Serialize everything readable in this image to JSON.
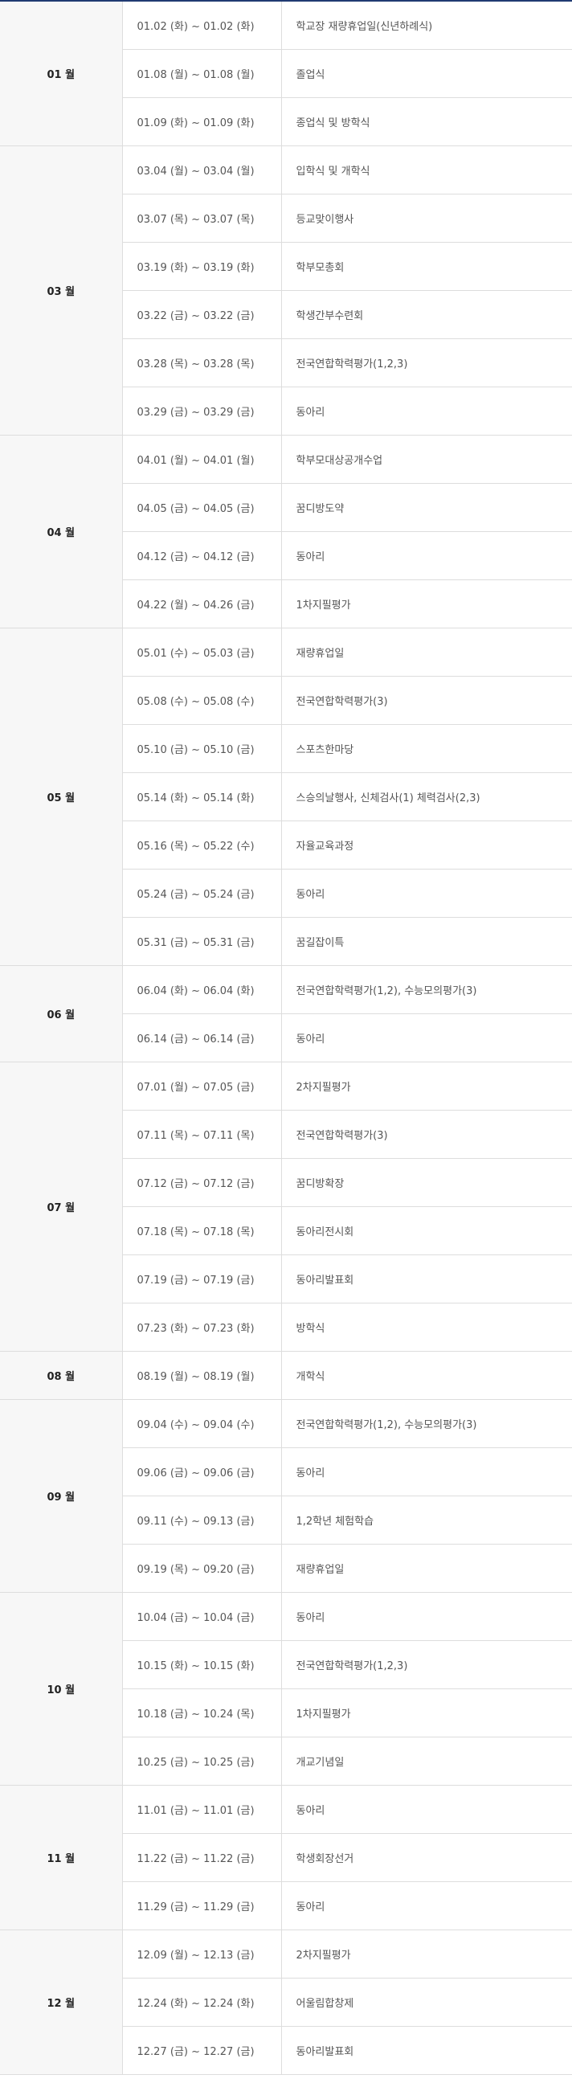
{
  "months": [
    {
      "label": "01 월",
      "rows": [
        {
          "date": "01.02 (화) ~ 01.02 (화)",
          "event": "학교장 재량휴업일(신년하례식)"
        },
        {
          "date": "01.08 (월) ~ 01.08 (월)",
          "event": "졸업식"
        },
        {
          "date": "01.09 (화) ~ 01.09 (화)",
          "event": "종업식 및 방학식"
        }
      ]
    },
    {
      "label": "03 월",
      "rows": [
        {
          "date": "03.04 (월) ~ 03.04 (월)",
          "event": "입학식 및 개학식"
        },
        {
          "date": "03.07 (목) ~ 03.07 (목)",
          "event": "등교맞이행사"
        },
        {
          "date": "03.19 (화) ~ 03.19 (화)",
          "event": "학부모총회"
        },
        {
          "date": "03.22 (금) ~ 03.22 (금)",
          "event": "학생간부수련회"
        },
        {
          "date": "03.28 (목) ~ 03.28 (목)",
          "event": "전국연합학력평가(1,2,3)"
        },
        {
          "date": "03.29 (금) ~ 03.29 (금)",
          "event": "동아리"
        }
      ]
    },
    {
      "label": "04 월",
      "rows": [
        {
          "date": "04.01 (월) ~ 04.01 (월)",
          "event": "학부모대상공개수업"
        },
        {
          "date": "04.05 (금) ~ 04.05 (금)",
          "event": "꿈디방도약"
        },
        {
          "date": "04.12 (금) ~ 04.12 (금)",
          "event": "동아리"
        },
        {
          "date": "04.22 (월) ~ 04.26 (금)",
          "event": "1차지필평가"
        }
      ]
    },
    {
      "label": "05 월",
      "rows": [
        {
          "date": "05.01 (수) ~ 05.03 (금)",
          "event": "재량휴업일"
        },
        {
          "date": "05.08 (수) ~ 05.08 (수)",
          "event": "전국연합학력평가(3)"
        },
        {
          "date": "05.10 (금) ~ 05.10 (금)",
          "event": "스포츠한마당"
        },
        {
          "date": "05.14 (화) ~ 05.14 (화)",
          "event": "스승의날행사, 신체검사(1) 체력검사(2,3)"
        },
        {
          "date": "05.16 (목) ~ 05.22 (수)",
          "event": "자율교육과정"
        },
        {
          "date": "05.24 (금) ~ 05.24 (금)",
          "event": "동아리"
        },
        {
          "date": "05.31 (금) ~ 05.31 (금)",
          "event": "꿈길잡이특"
        }
      ]
    },
    {
      "label": "06 월",
      "rows": [
        {
          "date": "06.04 (화) ~ 06.04 (화)",
          "event": "전국연합학력평가(1,2), 수능모의평가(3)"
        },
        {
          "date": "06.14 (금) ~ 06.14 (금)",
          "event": "동아리"
        }
      ]
    },
    {
      "label": "07 월",
      "rows": [
        {
          "date": "07.01 (월) ~ 07.05 (금)",
          "event": "2차지필평가"
        },
        {
          "date": "07.11 (목) ~ 07.11 (목)",
          "event": "전국연합학력평가(3)"
        },
        {
          "date": "07.12 (금) ~ 07.12 (금)",
          "event": "꿈디방확장"
        },
        {
          "date": "07.18 (목) ~ 07.18 (목)",
          "event": "동아리전시회"
        },
        {
          "date": "07.19 (금) ~ 07.19 (금)",
          "event": "동아리발표회"
        },
        {
          "date": "07.23 (화) ~ 07.23 (화)",
          "event": "방학식"
        }
      ]
    },
    {
      "label": "08 월",
      "rows": [
        {
          "date": "08.19 (월) ~ 08.19 (월)",
          "event": "개학식"
        }
      ]
    },
    {
      "label": "09 월",
      "rows": [
        {
          "date": "09.04 (수) ~ 09.04 (수)",
          "event": "전국연합학력평가(1,2), 수능모의평가(3)"
        },
        {
          "date": "09.06 (금) ~ 09.06 (금)",
          "event": "동아리"
        },
        {
          "date": "09.11 (수) ~ 09.13 (금)",
          "event": "1,2학년 체험학습"
        },
        {
          "date": "09.19 (목) ~ 09.20 (금)",
          "event": "재량휴업일"
        }
      ]
    },
    {
      "label": "10 월",
      "rows": [
        {
          "date": "10.04 (금) ~ 10.04 (금)",
          "event": "동아리"
        },
        {
          "date": "10.15 (화) ~ 10.15 (화)",
          "event": "전국연합학력평가(1,2,3)"
        },
        {
          "date": "10.18 (금) ~ 10.24 (목)",
          "event": "1차지필평가"
        },
        {
          "date": "10.25 (금) ~ 10.25 (금)",
          "event": "개교기념일"
        }
      ]
    },
    {
      "label": "11 월",
      "rows": [
        {
          "date": "11.01 (금) ~ 11.01 (금)",
          "event": "동아리"
        },
        {
          "date": "11.22 (금) ~ 11.22 (금)",
          "event": "학생회장선거"
        },
        {
          "date": "11.29 (금) ~ 11.29 (금)",
          "event": "동아리"
        }
      ]
    },
    {
      "label": "12 월",
      "rows": [
        {
          "date": "12.09 (월) ~ 12.13 (금)",
          "event": "2차지필평가"
        },
        {
          "date": "12.24 (화) ~ 12.24 (화)",
          "event": "어울림합창제"
        },
        {
          "date": "12.27 (금) ~ 12.27 (금)",
          "event": "동아리발표회"
        }
      ]
    }
  ]
}
